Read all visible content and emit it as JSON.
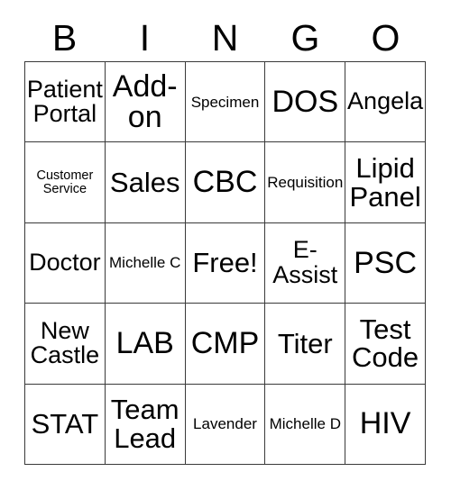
{
  "card": {
    "title": "BINGO",
    "headers": [
      "B",
      "I",
      "N",
      "G",
      "O"
    ],
    "free_space_label": "Free!",
    "colors": {
      "background": "#ffffff",
      "text": "#000000",
      "border": "#3a3a3a"
    },
    "grid_size": "5x5",
    "rows": [
      [
        {
          "text": "Patient Portal",
          "size": "md"
        },
        {
          "text": "Add-on",
          "size": "xl"
        },
        {
          "text": "Specimen",
          "size": "xs"
        },
        {
          "text": "DOS",
          "size": "xl"
        },
        {
          "text": "Angela",
          "size": "md"
        }
      ],
      [
        {
          "text": "Customer Service",
          "size": "xxs"
        },
        {
          "text": "Sales",
          "size": "lg"
        },
        {
          "text": "CBC",
          "size": "xl"
        },
        {
          "text": "Requisition",
          "size": "xs"
        },
        {
          "text": "Lipid Panel",
          "size": "lg"
        }
      ],
      [
        {
          "text": "Doctor",
          "size": "md"
        },
        {
          "text": "Michelle C",
          "size": "xs"
        },
        {
          "text": "Free!",
          "size": "lg"
        },
        {
          "text": "E-Assist",
          "size": "md"
        },
        {
          "text": "PSC",
          "size": "xl"
        }
      ],
      [
        {
          "text": "New Castle",
          "size": "md"
        },
        {
          "text": "LAB",
          "size": "xl"
        },
        {
          "text": "CMP",
          "size": "xl"
        },
        {
          "text": "Titer",
          "size": "lg"
        },
        {
          "text": "Test Code",
          "size": "lg"
        }
      ],
      [
        {
          "text": "STAT",
          "size": "lg"
        },
        {
          "text": "Team Lead",
          "size": "lg"
        },
        {
          "text": "Lavender",
          "size": "xs"
        },
        {
          "text": "Michelle D",
          "size": "xs"
        },
        {
          "text": "HIV",
          "size": "xl"
        }
      ]
    ]
  }
}
